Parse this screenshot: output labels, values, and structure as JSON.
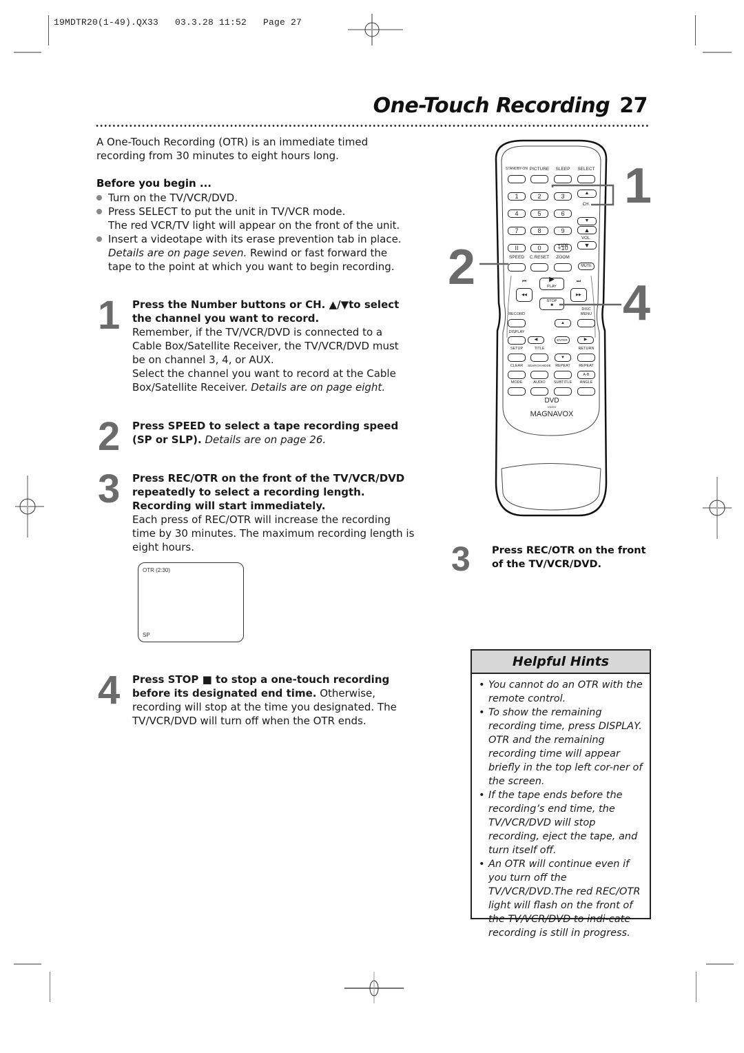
{
  "slug": {
    "file": "19MDTR20(1-49).QX33",
    "date": "03.3.28",
    "time": "11:52",
    "page_label": "Page",
    "page_num": "27",
    "full": "19MDTR20(1-49).QX33   03.3.28 11:52   Page 27"
  },
  "header": {
    "title": "One-Touch Recording",
    "page_number": "27"
  },
  "intro": "A One-Touch Recording (OTR) is an immediate timed recording from 30 minutes to eight hours long.",
  "before_you_begin": {
    "heading": "Before you begin ...",
    "items": [
      {
        "text": "Turn on the TV/VCR/DVD."
      },
      {
        "text": "Press SELECT to put the unit in TV/VCR mode.",
        "extra": "The red VCR/TV light will appear on the front of the unit."
      },
      {
        "text": "Insert a videotape with its erase prevention tab in place.",
        "italic": "Details are on page seven.",
        "extra": " Rewind or fast forward the tape to the point at which you want to begin recording."
      }
    ]
  },
  "steps": [
    {
      "num": "1",
      "bold": "Press the Number buttons or CH. ▲/▼to select the channel you want to record.",
      "text1": "Remember, if the TV/VCR/DVD is connected to a Cable Box/Satellite Receiver, the TV/VCR/DVD must be on channel 3, 4, or AUX.",
      "text2": "Select the channel you want to record at the Cable Box/Satellite Receiver. ",
      "italic": "Details are on page eight."
    },
    {
      "num": "2",
      "bold": "Press SPEED to select a tape recording speed (SP or SLP).",
      "italic": " Details are on page 26."
    },
    {
      "num": "3",
      "bold": "Press REC/OTR on the front of the TV/VCR/DVD repeatedly to select a recording length. Recording will start immediately.",
      "text1": "Each press of REC/OTR will increase the recording time by 30 minutes. The maximum recording length is eight hours."
    },
    {
      "num": "4",
      "bold": "Press STOP ■ to stop a one-touch recording before its designated end time.",
      "text1": " Otherwise, recording will stop at the time you designated. The TV/VCR/DVD will turn off when the OTR ends."
    }
  ],
  "osd": {
    "top_left": "OTR (2:30)",
    "bottom_left": "SP"
  },
  "remote": {
    "row1": [
      "STANDBY-ON",
      "PICTURE",
      "SLEEP",
      "SELECT"
    ],
    "numbers": [
      "1",
      "2",
      "3",
      "4",
      "5",
      "6",
      "7",
      "8",
      "9",
      "II",
      "0",
      "+10"
    ],
    "plus100": "+100",
    "ch_label": "CH.",
    "vol_label": "VOL.",
    "row_speed": [
      "SPEED",
      "C.RESET",
      "ZOOM"
    ],
    "mute": "MUTE",
    "play": "PLAY",
    "stop": "STOP",
    "record": "RECORD",
    "disc_menu": "DISC MENU",
    "display": "DISPLAY",
    "enter": "ENTER",
    "row_setup": [
      "SETUP",
      "TITLE",
      "RETURN"
    ],
    "row_clear": [
      "CLEAR",
      "SEARCH MODE",
      "REPEAT",
      "REPEAT"
    ],
    "ab": "A-B",
    "row_mode": [
      "MODE",
      "AUDIO",
      "SUBTITLE",
      "ANGLE"
    ],
    "dvd_logo": "DVD",
    "video": "VIDEO",
    "brand": "MAGNAVOX"
  },
  "callouts": {
    "one": "1",
    "two": "2",
    "four": "4"
  },
  "side_step": {
    "num": "3",
    "text": "Press REC/OTR on the front of the TV/VCR/DVD."
  },
  "hints": {
    "title": "Helpful Hints",
    "items": [
      "You cannot do an OTR with the remote control.",
      "To show the remaining recording time, press DISPLAY. OTR and the remaining recording time will appear briefly in the top left cor-ner of the screen.",
      "If the tape ends before the recording’s end time, the TV/VCR/DVD will stop recording, eject the tape, and turn itself off.",
      "An OTR will continue even if you turn off the TV/VCR/DVD.The red REC/OTR light will flash on the front of the TV/VCR/DVD to indi-cate recording is still in progress."
    ]
  }
}
